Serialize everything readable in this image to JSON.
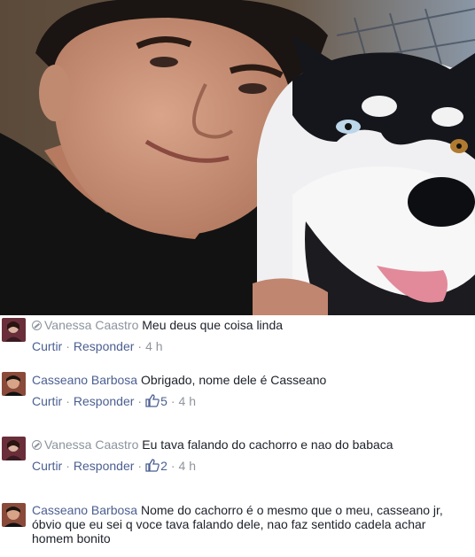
{
  "comments": [
    {
      "author": "Vanessa Caastro",
      "hidden": true,
      "text": "Meu deus que coisa linda",
      "like_label": "Curtir",
      "reply_label": "Responder",
      "time": "4 h"
    },
    {
      "author": "Casseano Barbosa",
      "hidden": false,
      "text": "Obrigado, nome dele é Casseano",
      "like_label": "Curtir",
      "reply_label": "Responder",
      "like_count": "5",
      "time": "4 h"
    },
    {
      "author": "Vanessa Caastro",
      "hidden": true,
      "text": "Eu tava falando do cachorro e nao do babaca",
      "like_label": "Curtir",
      "reply_label": "Responder",
      "like_count": "2",
      "time": "4 h"
    },
    {
      "author": "Casseano Barbosa",
      "hidden": false,
      "text": "Nome do cachorro é o mesmo que o meu, casseano jr, óbvio que eu sei q voce tava falando dele, nao faz sentido cadela achar homem bonito"
    }
  ],
  "colors": {
    "link": "#4b5f91",
    "meta": "#90949c",
    "text": "#1d2129"
  }
}
